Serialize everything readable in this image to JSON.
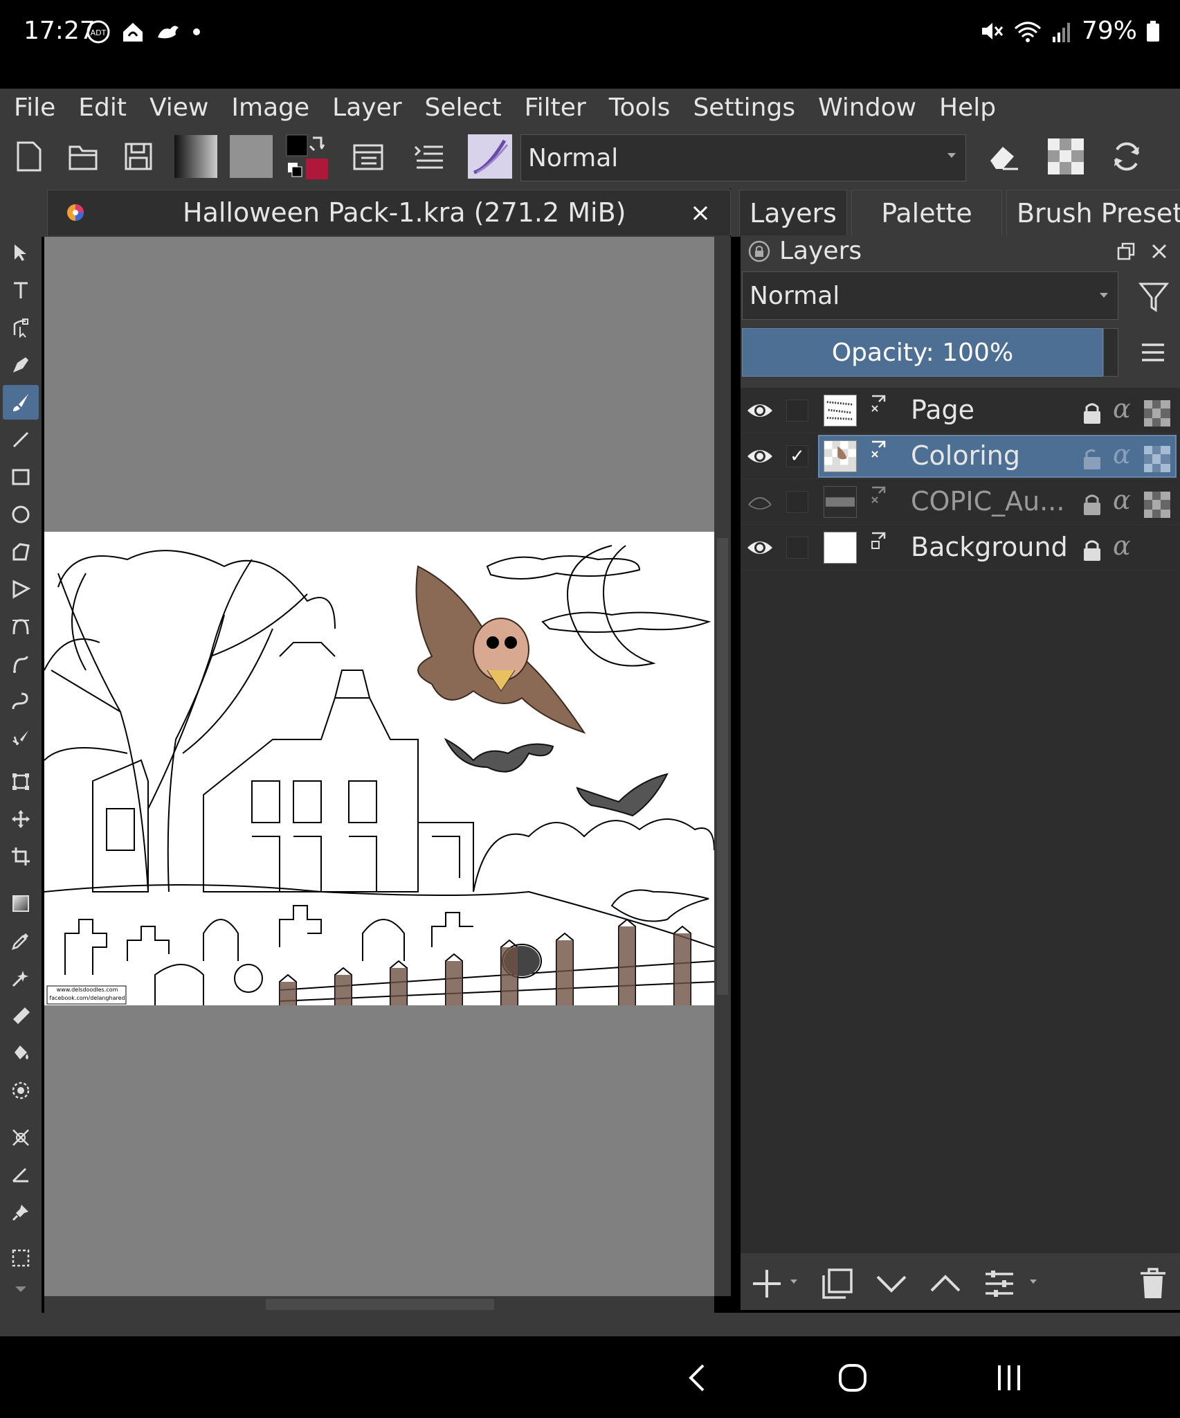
{
  "status_bar": {
    "time": "17:27",
    "battery": "79%",
    "left_icons": [
      "adt-icon",
      "smart-home-icon",
      "cloud-bird-icon",
      "dot-icon"
    ],
    "right_icons": [
      "mute-icon",
      "wifi-icon",
      "signal-icon",
      "battery-icon"
    ]
  },
  "menu": {
    "items": [
      "File",
      "Edit",
      "View",
      "Image",
      "Layer",
      "Select",
      "Filter",
      "Tools",
      "Settings",
      "Window",
      "Help"
    ]
  },
  "toolbar": {
    "blend_mode": "Normal"
  },
  "document": {
    "tab_title": "Halloween Pack-1.kra (271.2 MiB)",
    "close_glyph": "×",
    "watermark_line1": "www.delsdoodles.com",
    "watermark_line2": "facebook.com/delanghared"
  },
  "docker": {
    "tabs": [
      "Layers",
      "Palette",
      "Brush Presets"
    ],
    "active_tab": "Layers"
  },
  "layers_panel": {
    "title": "Layers",
    "blend_mode": "Normal",
    "opacity_label": "Opacity:  100%",
    "layers": [
      {
        "name": "Page",
        "visible": true,
        "checked": false,
        "selected": false
      },
      {
        "name": "Coloring",
        "visible": true,
        "checked": true,
        "selected": true
      },
      {
        "name": "COPIC_Au...",
        "visible": false,
        "checked": false,
        "selected": false
      },
      {
        "name": "Background",
        "visible": true,
        "checked": false,
        "selected": false
      }
    ],
    "alpha_glyph": "α",
    "check_glyph": "✓"
  },
  "colors": {
    "accent": "#4e6f94",
    "panel_bg": "#3a3a3a",
    "canvas_bg": "#808080",
    "background_color_swatch": "#b0183a"
  }
}
